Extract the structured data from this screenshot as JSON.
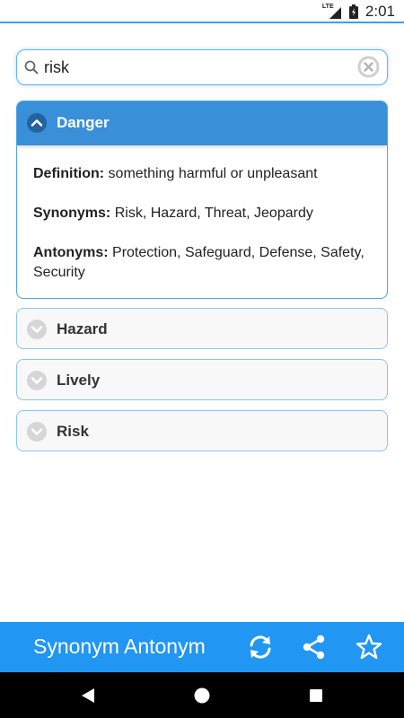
{
  "status_bar": {
    "network": "LTE",
    "time": "2:01"
  },
  "search": {
    "value": "risk",
    "placeholder": ""
  },
  "results": {
    "expanded": {
      "title": "Danger",
      "definition_label": "Definition:",
      "definition": "something harmful or unpleasant",
      "synonyms_label": "Synonyms:",
      "synonyms": "Risk, Hazard, Threat, Jeopardy",
      "antonyms_label": "Antonyms:",
      "antonyms": "Protection, Safeguard, Defense, Safety, Security"
    },
    "collapsed": [
      {
        "title": "Hazard"
      },
      {
        "title": "Lively"
      },
      {
        "title": "Risk"
      }
    ]
  },
  "app_bar": {
    "title": "Synonym Antonym",
    "actions": [
      "refresh-icon",
      "share-icon",
      "star-icon"
    ]
  },
  "colors": {
    "accent": "#2196f3",
    "header_expanded": "#3a8fd9",
    "border": "#64b4f0"
  }
}
